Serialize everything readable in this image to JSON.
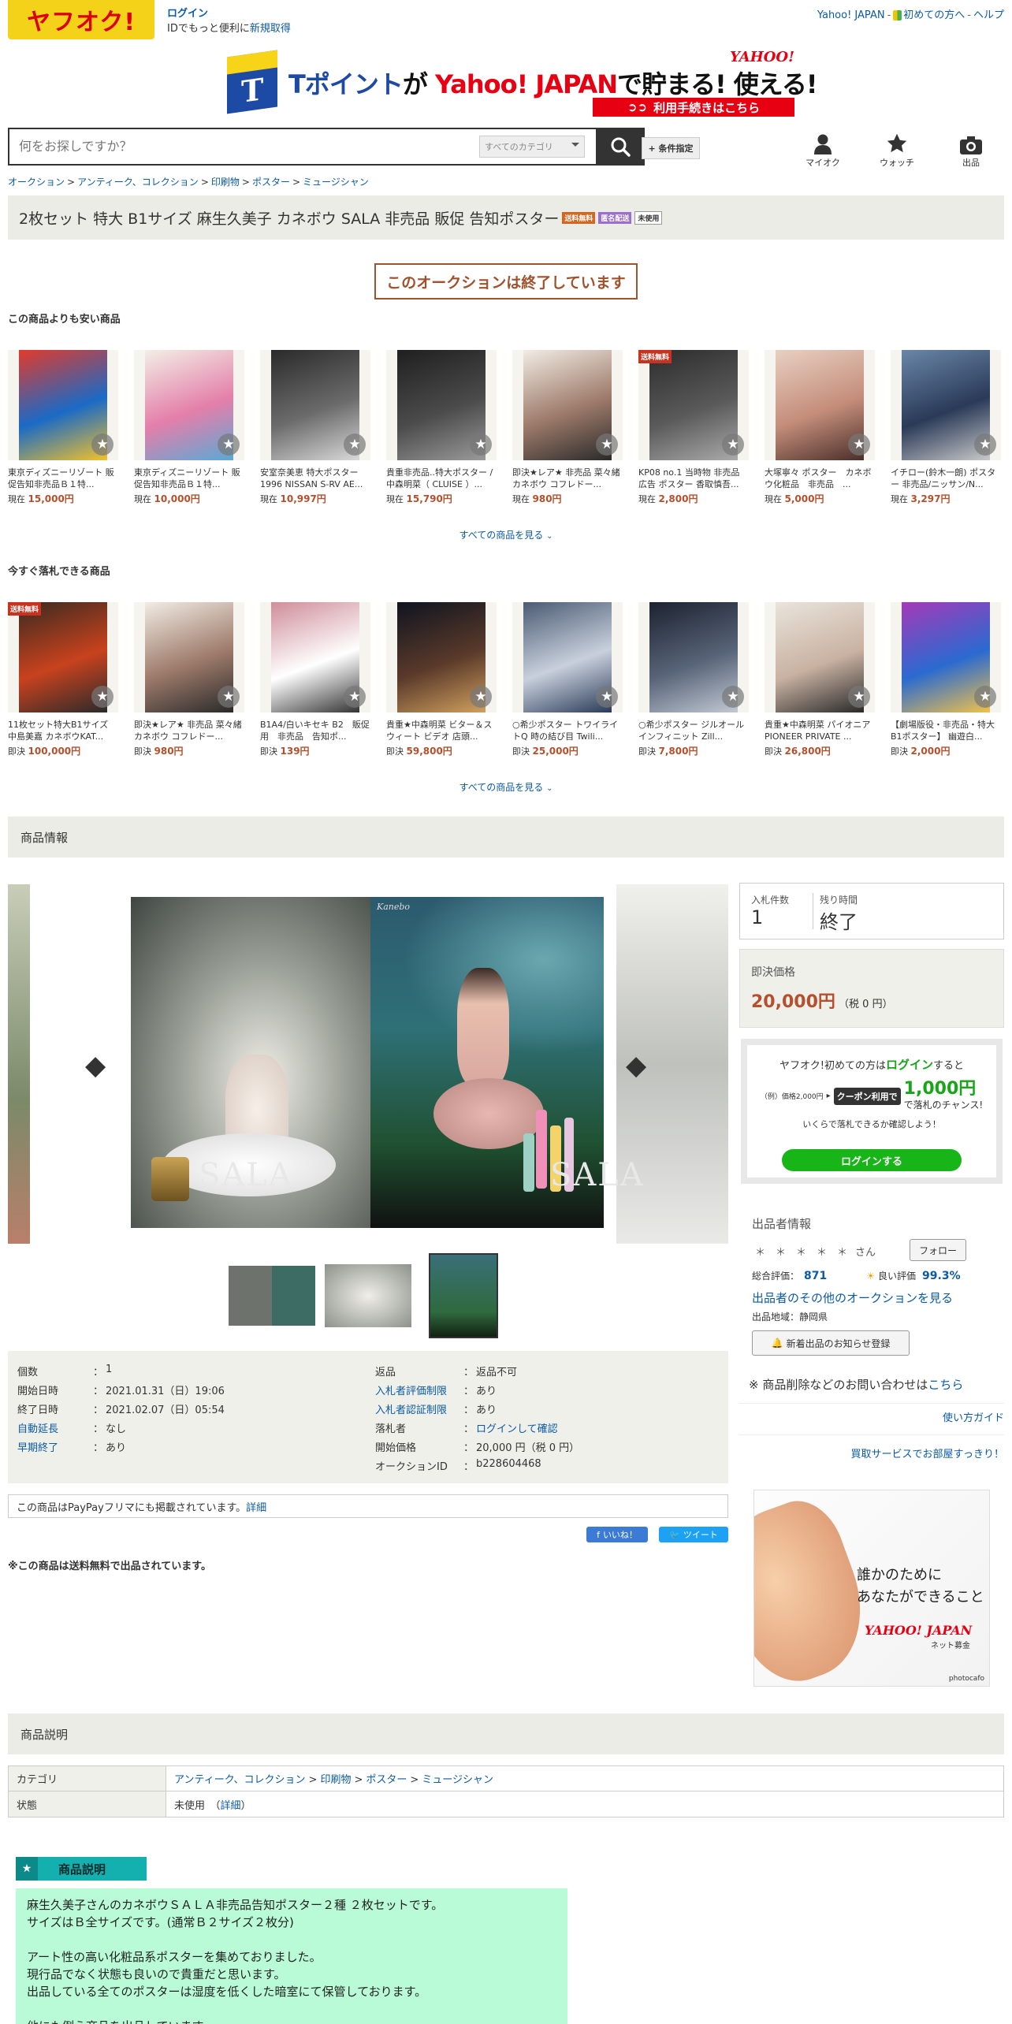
{
  "header": {
    "logo_text": "ヤフオク!",
    "login": "ログイン",
    "login_sub_pre": "IDでもっと便利に",
    "login_sub_link": "新規取得",
    "top_links": [
      "Yahoo! JAPAN",
      "初めての方へ",
      "ヘルプ"
    ]
  },
  "banner": {
    "text_tpoint": "Tポイント",
    "text_ga": "が",
    "text_yahoo": "Yahoo! JAPAN",
    "text_de": "で",
    "text_tamaru": "貯まる! 使える!",
    "logo": "YAHOO!",
    "cta": "利用手続きはこちら"
  },
  "search": {
    "placeholder": "何をお探しですか？",
    "category": "すべてのカテゴリ",
    "cond_button": "+ 条件指定",
    "icons": [
      {
        "label": "マイオク",
        "icon": "user-icon"
      },
      {
        "label": "ウォッチ",
        "icon": "star-icon"
      },
      {
        "label": "出品",
        "icon": "camera-icon"
      }
    ]
  },
  "breadcrumb": [
    "オークション",
    "アンティーク、コレクション",
    "印刷物",
    "ポスター",
    "ミュージシャン"
  ],
  "title": {
    "text": "2枚セット 特大 B1サイズ 麻生久美子 カネボウ SALA 非売品 販促 告知ポスター",
    "tags": [
      "送料無料",
      "匿名配送",
      "未使用"
    ],
    "tag_colors": [
      "#d9641e",
      "#9b6fd0",
      "#ffffff"
    ]
  },
  "ended": "このオークションは終了しています",
  "cheaper": {
    "heading": "この商品よりも安い商品",
    "see_all": "すべての商品を見る",
    "items": [
      {
        "name": "東京ディズニーリゾート 販促告知非売品Ｂ１特...",
        "prefix": "現在",
        "price": "15,000円",
        "free": ""
      },
      {
        "name": "東京ディズニーリゾート 販促告知非売品Ｂ１特...",
        "prefix": "現在",
        "price": "10,000円",
        "free": ""
      },
      {
        "name": "安室奈美恵 特大ポスター 1996 NISSAN S-RV AE...",
        "prefix": "現在",
        "price": "10,997円",
        "free": ""
      },
      {
        "name": "貴重非売品..特大ポスター / 中森明菜（ CLUISE ）...",
        "prefix": "現在",
        "price": "15,790円",
        "free": ""
      },
      {
        "name": "即決★レア★ 非売品 菜々緒 カネボウ コフレドー...",
        "prefix": "現在",
        "price": "980円",
        "free": ""
      },
      {
        "name": "KP08 no.1 当時物 非売品 広告 ポスター 香取慎吾...",
        "prefix": "現在",
        "price": "2,800円",
        "free": "送料無料"
      },
      {
        "name": "大塚寧々 ポスター　カネボウ化粧品　非売品　...",
        "prefix": "現在",
        "price": "5,000円",
        "free": ""
      },
      {
        "name": "イチロー(鈴木一朗) ポスター 非売品/ニッサン/N...",
        "prefix": "現在",
        "price": "3,297円",
        "free": ""
      }
    ]
  },
  "buynow": {
    "heading": "今すぐ落札できる商品",
    "see_all": "すべての商品を見る",
    "items": [
      {
        "name": "11枚セット特大B1サイズ 中島美嘉 カネボウKAT...",
        "prefix": "即決",
        "price": "100,000円",
        "free": "送料無料"
      },
      {
        "name": "即決★レア★ 非売品 菜々緒 カネボウ コフレドー...",
        "prefix": "即決",
        "price": "980円",
        "free": ""
      },
      {
        "name": "B1A4/白いキセキ B2　販促用　非売品　告知ポ...",
        "prefix": "即決",
        "price": "139円",
        "free": ""
      },
      {
        "name": "貴重★中森明菜 ビター＆スウィート ビデオ 店頭...",
        "prefix": "即決",
        "price": "59,800円",
        "free": ""
      },
      {
        "name": "○希少ポスター トワイライトQ 時の結び目 Twili...",
        "prefix": "即決",
        "price": "25,000円",
        "free": ""
      },
      {
        "name": "○希少ポスター ジルオール　インフィニット Zill...",
        "prefix": "即決",
        "price": "7,800円",
        "free": ""
      },
      {
        "name": "貴重★中森明菜 パイオニア PIONEER PRIVATE ...",
        "prefix": "即決",
        "price": "26,800円",
        "free": ""
      },
      {
        "name": "【劇場版役・非売品・特大B1ポスター】 幽遊白...",
        "prefix": "即決",
        "price": "2,000円",
        "free": ""
      }
    ]
  },
  "product_info_heading": "商品情報",
  "gallery": {
    "brand": "Kanebo",
    "sala": "SALA"
  },
  "details_left": [
    {
      "k": "個数",
      "v": "1",
      "link": false
    },
    {
      "k": "開始日時",
      "v": "2021.01.31（日）19:06",
      "link": false
    },
    {
      "k": "終了日時",
      "v": "2021.02.07（日）05:54",
      "link": false
    },
    {
      "k": "自動延長",
      "v": "なし",
      "link": true
    },
    {
      "k": "早期終了",
      "v": "あり",
      "link": true
    }
  ],
  "details_right": [
    {
      "k": "返品",
      "v": "返品不可",
      "link": false,
      "vlink": false
    },
    {
      "k": "入札者評価制限",
      "v": "あり",
      "link": true,
      "vlink": false
    },
    {
      "k": "入札者認証制限",
      "v": "あり",
      "link": true,
      "vlink": false
    },
    {
      "k": "落札者",
      "v": "ログインして確認",
      "link": false,
      "vlink": true
    },
    {
      "k": "開始価格",
      "v": "20,000 円（税 0 円）",
      "link": false,
      "vlink": false
    },
    {
      "k": "オークションID",
      "v": "b228604468",
      "link": false,
      "vlink": false
    }
  ],
  "paypay": {
    "text": "この商品はPayPayフリマにも掲載されています。",
    "link": "詳細"
  },
  "social": {
    "like": "いいね！",
    "tweet": "ツイート"
  },
  "free_note": "※この商品は送料無料で出品されています。",
  "bids": {
    "count_label": "入札件数",
    "count": "1",
    "time_label": "残り時間",
    "time": "終了"
  },
  "buy": {
    "label": "即決価格",
    "price": "20,000円",
    "tax": "（税 0 円）"
  },
  "promo": {
    "line1_pre": "ヤフオク!初めての方は",
    "line1_link": "ログイン",
    "line1_post": "すると",
    "example": "（例）価格2,000円",
    "coupon_label": "クーポン利用で",
    "amount": "1,000円",
    "amount_post": "で落札のチャンス!",
    "line3": "いくらで落札できるか確認しよう！",
    "button": "ログインする"
  },
  "seller": {
    "heading": "出品者情報",
    "name": "＊　＊　＊　＊　＊",
    "san": "さん",
    "follow": "フォロー",
    "rating_label": "総合評価：",
    "rating": "871",
    "good_label": "良い評価",
    "good": "99.3%",
    "other_link": "出品者のその他のオークションを見る",
    "region": "出品地域：静岡県",
    "alert_btn": "新着出品のお知らせ登録"
  },
  "inquiry": {
    "text": "※ 商品削除などのお問い合わせは",
    "link": "こちら"
  },
  "guide": "使い方ガイド",
  "buyservice": "買取サービスでお部屋すっきり！",
  "ad": {
    "line1": "誰かのために",
    "line2": "あなたができること",
    "brand": "YAHOO! JAPAN",
    "brand_sub": "ネット募金",
    "credit": "photocafo"
  },
  "description_heading": "商品説明",
  "category_table": {
    "cat_label": "カテゴリ",
    "cats": [
      "アンティーク、コレクション",
      "印刷物",
      "ポスター",
      "ミュージシャン"
    ],
    "cond_label": "状態",
    "cond": "未使用",
    "cond_link": "詳細"
  },
  "desc_box": {
    "title": "商品説明",
    "lines": [
      "麻生久美子さんのカネボウＳＡＬＡ非売品告知ポスター２種 ２枚セットです。",
      "サイズはＢ全サイズです。(通常Ｂ２サイズ２枚分)",
      "",
      "アート性の高い化粧品系ポスターを集めておりました。",
      "現行品でなく状態も良いので貴重だと思います。",
      "出品している全てのポスターは湿度を低くした暗室にて保管しております。",
      "",
      "他にも例え商品を出品しています。"
    ]
  }
}
